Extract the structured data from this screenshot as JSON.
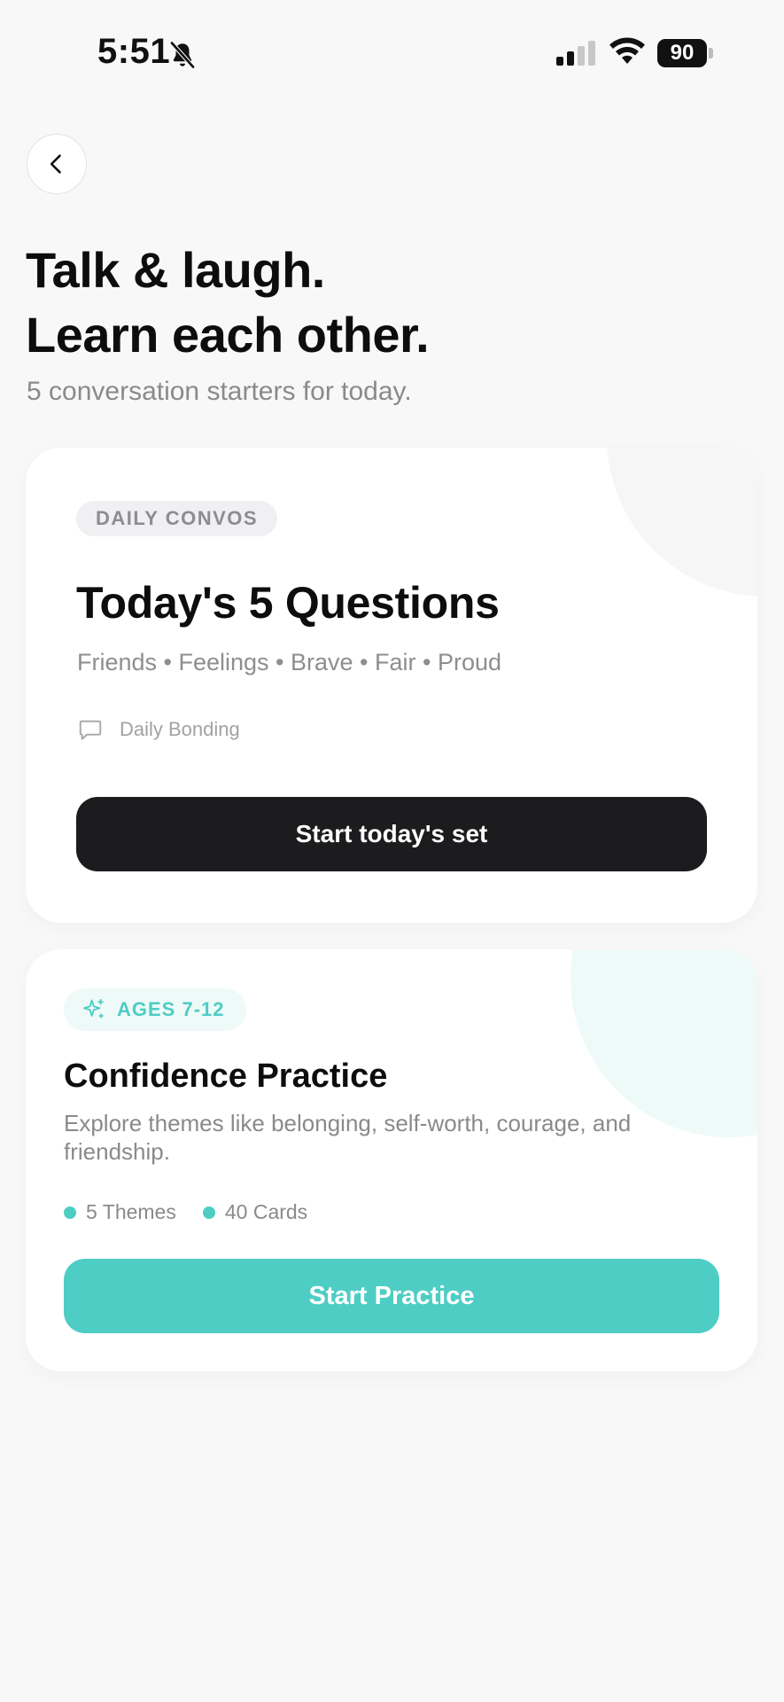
{
  "status_bar": {
    "time": "5:51",
    "battery_level": "90",
    "icons": [
      "bell-slash-icon",
      "signal-icon",
      "wifi-icon",
      "battery-icon"
    ]
  },
  "nav": {
    "back_icon": "chevron-left-icon"
  },
  "hero": {
    "title_line1": "Talk & laugh.",
    "title_line2": "Learn each other.",
    "subtitle": "5 conversation starters for today."
  },
  "daily_card": {
    "badge": "DAILY CONVOS",
    "title": "Today's 5 Questions",
    "topics": "Friends • Feelings • Brave • Fair • Proud",
    "meta_icon": "chat-bubble-icon",
    "meta_label": "Daily Bonding",
    "button_label": "Start today's set"
  },
  "practice_card": {
    "badge_icon": "sparkle-icon",
    "badge": "AGES 7-12",
    "title": "Confidence Practice",
    "description": "Explore themes like belonging, self-worth, courage, and friendship.",
    "stats": [
      {
        "label": "5 Themes"
      },
      {
        "label": "40 Cards"
      }
    ],
    "button_label": "Start Practice"
  },
  "colors": {
    "background": "#f8f8f8",
    "card": "#ffffff",
    "primary_dark": "#1c1c1e",
    "accent_teal": "#4ecdc4",
    "muted_text": "#8a8a8a"
  }
}
